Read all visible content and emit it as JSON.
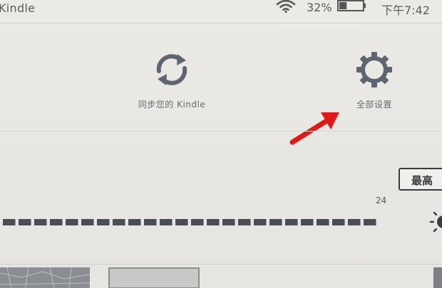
{
  "status": {
    "title": "Kindle",
    "battery": "32%",
    "time": "下午7:42"
  },
  "actions": {
    "sync_label": "同步您的 Kindle",
    "settings_label": "全部设置"
  },
  "brightness": {
    "level": 24,
    "value_label": "24",
    "max_label": "最高"
  },
  "colors": {
    "annotation_arrow": "#e01818",
    "icon_gray": "#5f6570"
  },
  "icons": {
    "sync": "sync-icon",
    "settings": "gear-icon",
    "wifi": "wifi-icon",
    "battery": "battery-icon",
    "brightness": "sun-icon"
  }
}
